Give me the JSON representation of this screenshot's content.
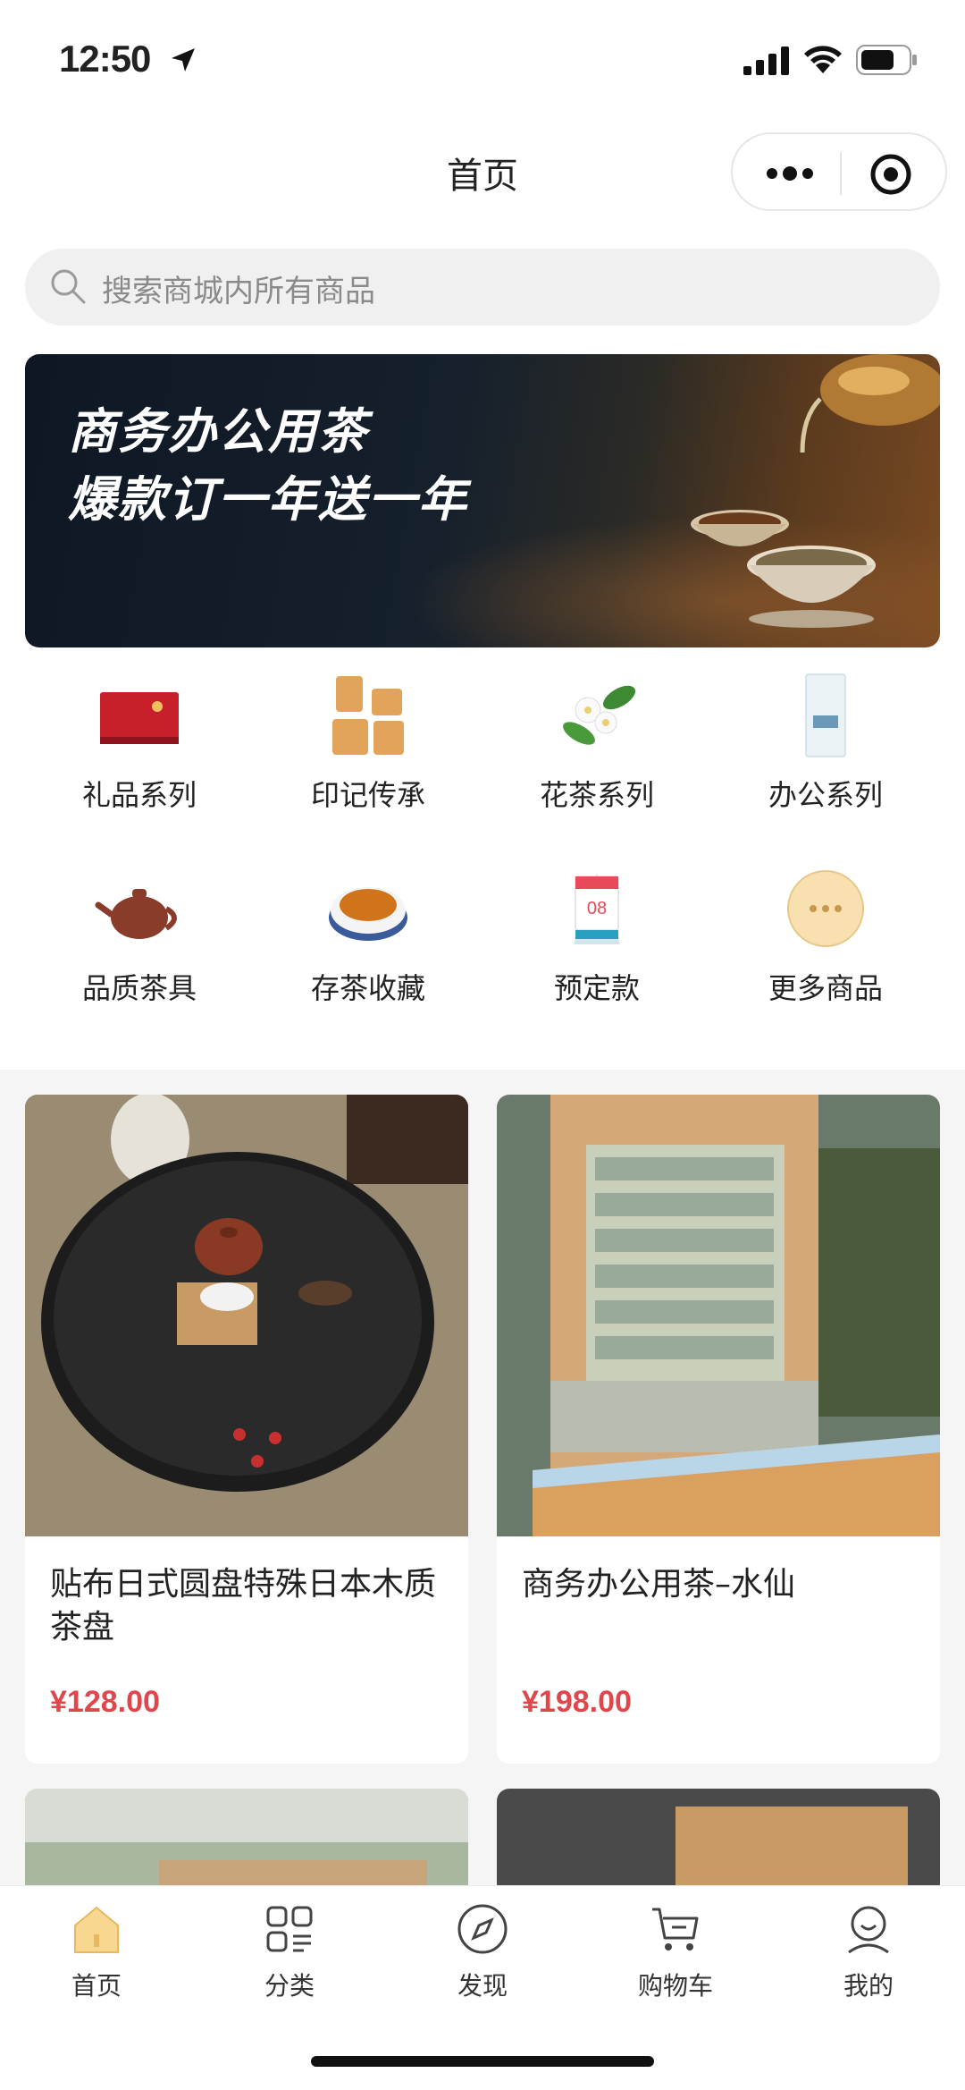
{
  "status_bar": {
    "time": "12:50"
  },
  "nav": {
    "title": "首页"
  },
  "search": {
    "placeholder": "搜索商城内所有商品"
  },
  "banner": {
    "line1": "商务办公用茶",
    "line2": "爆款订一年送一年"
  },
  "categories": [
    {
      "label": "礼品系列",
      "icon": "gift-box-icon"
    },
    {
      "label": "印记传承",
      "icon": "brand-logo-icon"
    },
    {
      "label": "花茶系列",
      "icon": "jasmine-flower-icon"
    },
    {
      "label": "办公系列",
      "icon": "tea-pack-icon"
    },
    {
      "label": "品质茶具",
      "icon": "teapot-icon"
    },
    {
      "label": "存茶收藏",
      "icon": "tea-bowl-icon"
    },
    {
      "label": "预定款",
      "icon": "calendar-icon"
    },
    {
      "label": "更多商品",
      "icon": "more-dots-icon"
    }
  ],
  "products": [
    {
      "title": "贴布日式圆盘特殊日本木质茶盘",
      "price": "¥128.00"
    },
    {
      "title": "商务办公用茶–水仙",
      "price": "¥198.00"
    }
  ],
  "tabbar": [
    {
      "label": "首页",
      "icon": "home-icon",
      "active": true
    },
    {
      "label": "分类",
      "icon": "category-icon"
    },
    {
      "label": "发现",
      "icon": "compass-icon"
    },
    {
      "label": "购物车",
      "icon": "cart-icon"
    },
    {
      "label": "我的",
      "icon": "profile-icon"
    }
  ],
  "colors": {
    "price": "#e0474c",
    "accent": "#f5c46a"
  }
}
